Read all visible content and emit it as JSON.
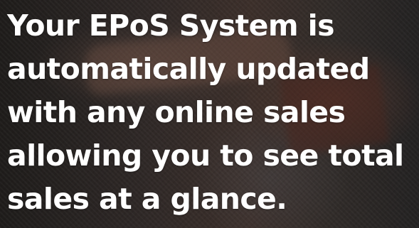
{
  "headline": {
    "lines": [
      "Your EPoS System is",
      "automatically updated",
      "with any online sales",
      "allowing you to see total",
      "sales at a glance."
    ]
  },
  "background": {
    "description_colors": {
      "base": "#2a2523",
      "text": "#ffffff"
    }
  }
}
